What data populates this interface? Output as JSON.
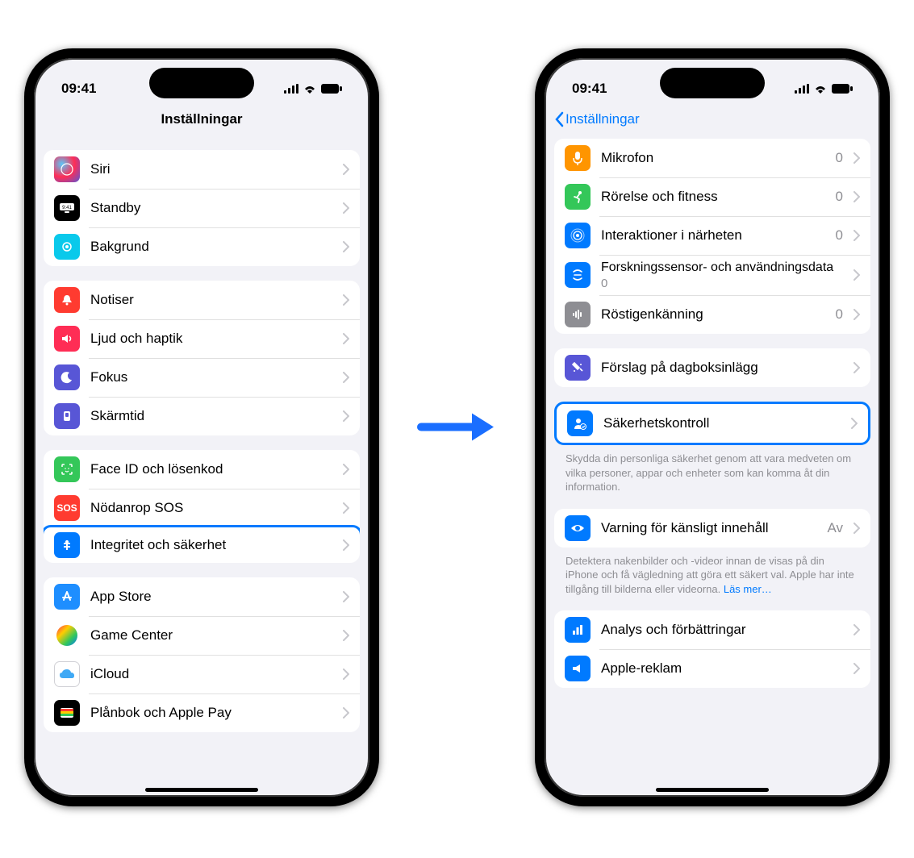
{
  "time": "09:41",
  "phone1": {
    "title": "Inställningar",
    "groups": [
      {
        "rows": [
          {
            "id": "siri",
            "label": "Siri"
          },
          {
            "id": "standby",
            "label": "Standby"
          },
          {
            "id": "bakgrund",
            "label": "Bakgrund"
          }
        ]
      },
      {
        "rows": [
          {
            "id": "notiser",
            "label": "Notiser"
          },
          {
            "id": "ljud",
            "label": "Ljud och haptik"
          },
          {
            "id": "fokus",
            "label": "Fokus"
          },
          {
            "id": "skarmtid",
            "label": "Skärmtid"
          }
        ]
      },
      {
        "rows": [
          {
            "id": "faceid",
            "label": "Face ID och lösenkod"
          },
          {
            "id": "sos",
            "label": "Nödanrop SOS"
          },
          {
            "id": "integritet",
            "label": "Integritet och säkerhet",
            "highlight": true
          }
        ]
      },
      {
        "rows": [
          {
            "id": "appstore",
            "label": "App Store"
          },
          {
            "id": "gamecenter",
            "label": "Game Center"
          },
          {
            "id": "icloud",
            "label": "iCloud"
          },
          {
            "id": "wallet",
            "label": "Plånbok och Apple Pay"
          }
        ]
      }
    ]
  },
  "phone2": {
    "back": "Inställningar",
    "groups": [
      {
        "rows": [
          {
            "id": "mikrofon",
            "label": "Mikrofon",
            "value": "0"
          },
          {
            "id": "rorelse",
            "label": "Rörelse och fitness",
            "value": "0"
          },
          {
            "id": "interaktioner",
            "label": "Interaktioner i närheten",
            "value": "0"
          },
          {
            "id": "forskning",
            "label": "Forskningssensor- och användningsdata",
            "sub": "0"
          },
          {
            "id": "rost",
            "label": "Röstigenkänning",
            "value": "0"
          }
        ]
      },
      {
        "rows": [
          {
            "id": "dagbok",
            "label": "Förslag på dagboksinlägg"
          }
        ]
      },
      {
        "highlight": true,
        "rows": [
          {
            "id": "sakerhet",
            "label": "Säkerhetskontroll"
          }
        ],
        "footer": "Skydda din personliga säkerhet genom att vara medveten om vilka personer, appar och enheter som kan komma åt din information."
      },
      {
        "rows": [
          {
            "id": "varning",
            "label": "Varning för känsligt innehåll",
            "value": "Av"
          }
        ],
        "footer": "Detektera nakenbilder och -videor innan de visas på din iPhone och få vägledning att göra ett säkert val. Apple har inte tillgång till bilderna eller videorna. ",
        "footer_link": "Läs mer…"
      },
      {
        "rows": [
          {
            "id": "analys",
            "label": "Analys och förbättringar"
          },
          {
            "id": "reklam",
            "label": "Apple-reklam"
          }
        ]
      }
    ]
  }
}
